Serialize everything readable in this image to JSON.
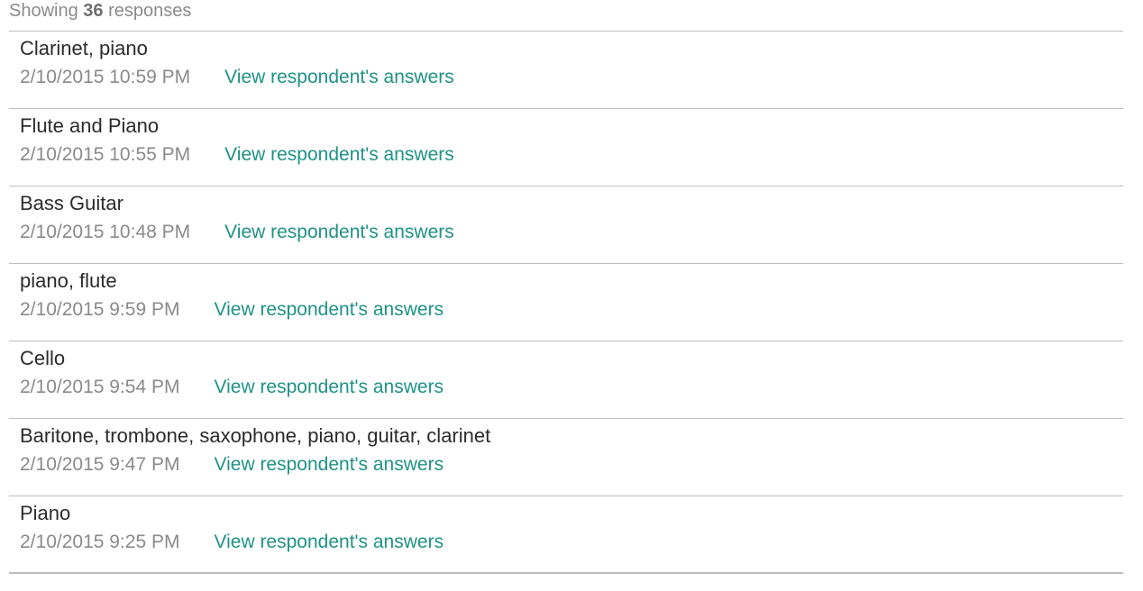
{
  "summary": {
    "prefix": "Showing",
    "count": "36",
    "suffix": "responses"
  },
  "responses": [
    {
      "answer": "Clarinet, piano",
      "date": "2/10/2015 10:59 PM",
      "link": "View respondent's answers"
    },
    {
      "answer": "Flute and Piano",
      "date": "2/10/2015 10:55 PM",
      "link": "View respondent's answers"
    },
    {
      "answer": "Bass Guitar",
      "date": "2/10/2015 10:48 PM",
      "link": "View respondent's answers"
    },
    {
      "answer": "piano, flute",
      "date": "2/10/2015 9:59 PM",
      "link": "View respondent's answers"
    },
    {
      "answer": "Cello",
      "date": "2/10/2015 9:54 PM",
      "link": "View respondent's answers"
    },
    {
      "answer": "Baritone, trombone, saxophone, piano, guitar, clarinet",
      "date": "2/10/2015 9:47 PM",
      "link": "View respondent's answers"
    },
    {
      "answer": "Piano",
      "date": "2/10/2015 9:25 PM",
      "link": "View respondent's answers"
    }
  ],
  "colors": {
    "link": "#1e9285",
    "answer_text": "#2b2b2b",
    "meta_text": "#8a8a8a",
    "divider": "#bdbdbd"
  }
}
